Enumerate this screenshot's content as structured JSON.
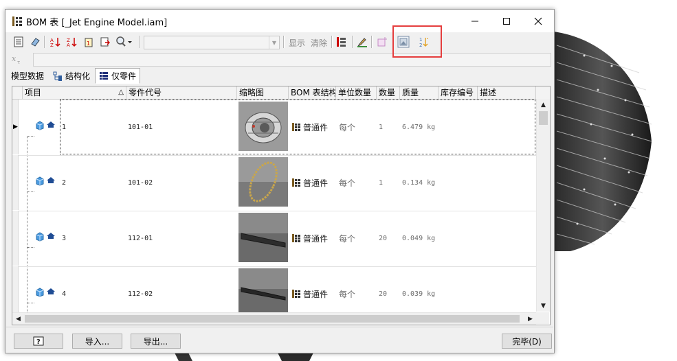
{
  "window": {
    "title": "BOM 表 [_Jet Engine Model.iam]",
    "minimize": "—",
    "maximize": "☐",
    "close": "✕"
  },
  "toolbar": {
    "show_label": "显示",
    "clear_label": "清除",
    "combo_value": "",
    "highlight_color": "#e53e3e"
  },
  "formula": {
    "fx_label": "x",
    "value": ""
  },
  "tabs": [
    {
      "label": "模型数据",
      "icon": "none"
    },
    {
      "label": "结构化",
      "icon": "structure-icon"
    },
    {
      "label": "仅零件",
      "icon": "parts-only-icon"
    }
  ],
  "columns": [
    "项目",
    "零件代号",
    "缩略图",
    "BOM 表结构",
    "单位数量",
    "数量",
    "质量",
    "库存编号",
    "描述"
  ],
  "sort_indicator": "△",
  "rows": [
    {
      "item": "1",
      "part_number": "101-01",
      "structure": "普通件",
      "unit_qty": "每个",
      "qty": "1",
      "mass": "6.479 kg",
      "thumb": "engine-assembly"
    },
    {
      "item": "2",
      "part_number": "101-02",
      "structure": "普通件",
      "unit_qty": "每个",
      "qty": "1",
      "mass": "0.134 kg",
      "thumb": "ring"
    },
    {
      "item": "3",
      "part_number": "112-01",
      "structure": "普通件",
      "unit_qty": "每个",
      "qty": "20",
      "mass": "0.049 kg",
      "thumb": "blade"
    },
    {
      "item": "4",
      "part_number": "112-02",
      "structure": "普通件",
      "unit_qty": "每个",
      "qty": "20",
      "mass": "0.039 kg",
      "thumb": "blade"
    }
  ],
  "footer": {
    "help_label": "?",
    "import_label": "导入...",
    "export_label": "导出...",
    "done_label": "完毕(D)"
  }
}
